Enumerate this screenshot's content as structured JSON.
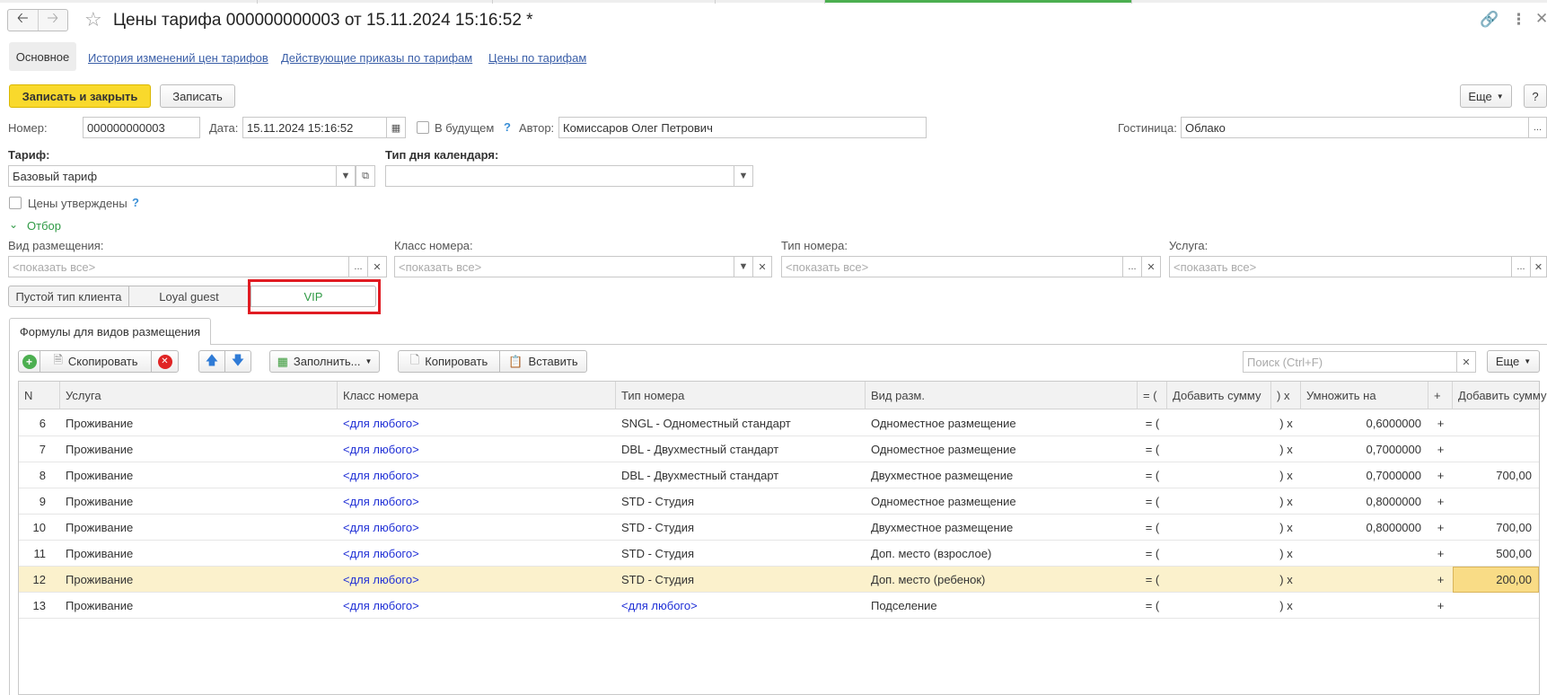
{
  "window": {
    "title": "Цены тарифа 000000000003 от 15.11.2024 15:16:52 *",
    "icons": [
      "link-icon",
      "more-vertical-icon",
      "close-icon"
    ]
  },
  "nav_tabs": {
    "main": "Основное",
    "links": [
      "История изменений цен тарифов",
      "Действующие приказы по тарифам",
      "Цены по тарифам"
    ]
  },
  "toolbar": {
    "save_close": "Записать и закрыть",
    "save": "Записать",
    "more": "Еще",
    "help": "?"
  },
  "fields": {
    "number_label": "Номер:",
    "number_value": "000000000003",
    "date_label": "Дата:",
    "date_value": "15.11.2024 15:16:52",
    "future_label": "В будущем",
    "future_help": "?",
    "author_label": "Автор:",
    "author_value": "Комиссаров Олег Петрович",
    "hotel_label": "Гостиница:",
    "hotel_value": "Облако",
    "tariff_label": "Тариф:",
    "tariff_value": "Базовый тариф",
    "calendar_label": "Тип дня календаря:",
    "calendar_value": "",
    "approved_label": "Цены утверждены",
    "approved_help": "?",
    "filter_label": "Отбор"
  },
  "filters": [
    {
      "label": "Вид размещения:",
      "placeholder": "<показать все>"
    },
    {
      "label": "Класс номера:",
      "placeholder": "<показать все>"
    },
    {
      "label": "Тип номера:",
      "placeholder": "<показать все>"
    },
    {
      "label": "Услуга:",
      "placeholder": "<показать все>"
    }
  ],
  "client_types": [
    "Пустой тип клиента",
    "Loyal guest",
    "VIP"
  ],
  "subtab": "Формулы для видов размещения",
  "table_toolbar": {
    "copy": "Скопировать",
    "fill": "Заполнить...",
    "copy2": "Копировать",
    "paste": "Вставить",
    "search_placeholder": "Поиск (Ctrl+F)",
    "more": "Еще"
  },
  "columns": [
    "N",
    "Услуга",
    "Класс номера",
    "Тип номера",
    "Вид разм.",
    "= (",
    "Добавить сумму",
    ") x",
    "Умножить на",
    "+",
    "Добавить сумму"
  ],
  "rows": [
    {
      "n": "6",
      "service": "Проживание",
      "class": "<для любого>",
      "type": "SNGL - Одноместный стандарт",
      "type_link": false,
      "acc": "Одноместное размещение",
      "op1": "= (",
      "add1": "",
      "op2": ") x",
      "mul": "0,6000000",
      "op3": "+",
      "add2": ""
    },
    {
      "n": "7",
      "service": "Проживание",
      "class": "<для любого>",
      "type": "DBL - Двухместный стандарт",
      "type_link": false,
      "acc": "Одноместное размещение",
      "op1": "= (",
      "add1": "",
      "op2": ") x",
      "mul": "0,7000000",
      "op3": "+",
      "add2": ""
    },
    {
      "n": "8",
      "service": "Проживание",
      "class": "<для любого>",
      "type": "DBL - Двухместный стандарт",
      "type_link": false,
      "acc": "Двухместное размещение",
      "op1": "= (",
      "add1": "",
      "op2": ") x",
      "mul": "0,7000000",
      "op3": "+",
      "add2": "700,00"
    },
    {
      "n": "9",
      "service": "Проживание",
      "class": "<для любого>",
      "type": "STD - Студия",
      "type_link": false,
      "acc": "Одноместное размещение",
      "op1": "= (",
      "add1": "",
      "op2": ") x",
      "mul": "0,8000000",
      "op3": "+",
      "add2": ""
    },
    {
      "n": "10",
      "service": "Проживание",
      "class": "<для любого>",
      "type": "STD - Студия",
      "type_link": false,
      "acc": "Двухместное размещение",
      "op1": "= (",
      "add1": "",
      "op2": ") x",
      "mul": "0,8000000",
      "op3": "+",
      "add2": "700,00"
    },
    {
      "n": "11",
      "service": "Проживание",
      "class": "<для любого>",
      "type": "STD - Студия",
      "type_link": false,
      "acc": "Доп. место (взрослое)",
      "op1": "= (",
      "add1": "",
      "op2": ") x",
      "mul": "",
      "op3": "+",
      "add2": "500,00"
    },
    {
      "n": "12",
      "service": "Проживание",
      "class": "<для любого>",
      "type": "STD - Студия",
      "type_link": false,
      "acc": "Доп. место (ребенок)",
      "op1": "= (",
      "add1": "",
      "op2": ") x",
      "mul": "",
      "op3": "+",
      "add2": "200,00"
    },
    {
      "n": "13",
      "service": "Проживание",
      "class": "<для любого>",
      "type": "<для любого>",
      "type_link": true,
      "acc": "Подселение",
      "op1": "= (",
      "add1": "",
      "op2": ") x",
      "mul": "",
      "op3": "+",
      "add2": ""
    }
  ],
  "selected_row": "12",
  "colors": {
    "accent_yellow": "#f9d92c",
    "link_blue": "#1f2fd6",
    "selected_row": "#fbf1cc",
    "vip_green": "#2f9a45",
    "highlight_red": "#e01b22"
  }
}
